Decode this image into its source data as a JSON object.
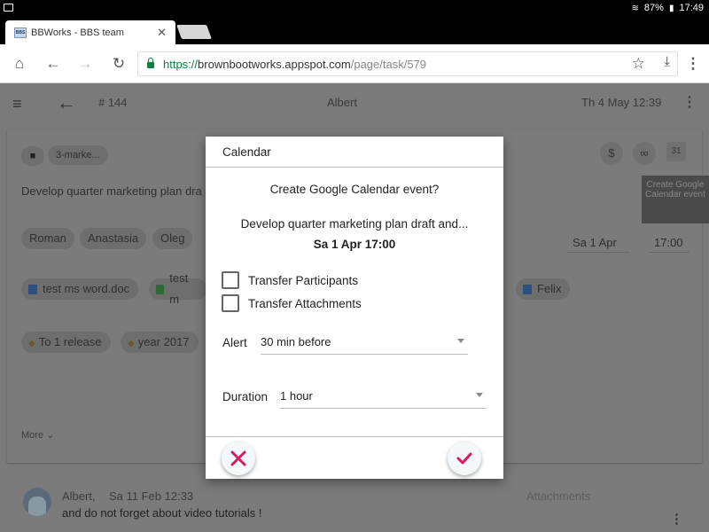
{
  "status_bar": {
    "battery": "87%",
    "time": "17:49"
  },
  "browser": {
    "tab": {
      "favicon_text": "BBS",
      "title": "BBWorks - BBS team"
    },
    "url": {
      "scheme": "https://",
      "host": "brownbootworks.appspot.com",
      "path": "/page/task/579"
    }
  },
  "app_header": {
    "task_number": "# 144",
    "user": "Albert",
    "datetime": "Th 4 May 12:39"
  },
  "task": {
    "folder_label": "3-marke...",
    "title": "Develop quarter marketing plan dra",
    "participants": [
      "Roman",
      "Anastasia",
      "Oleg"
    ],
    "date": "Sa 1 Apr",
    "time": "17:00",
    "attachments": [
      "test ms word.doc",
      "test m"
    ],
    "contact": "Felix",
    "tags": [
      "To 1 release",
      "year 2017"
    ],
    "more_label": "More",
    "tooltip": "Create Google Calendar event"
  },
  "comment": {
    "author": "Albert,",
    "date": "Sa 11 Feb 12:33",
    "text": "and do not forget about video tutorials !",
    "attachments_label": "Attachments"
  },
  "modal": {
    "title": "Calendar",
    "question": "Create Google Calendar event?",
    "task_name": "Develop quarter marketing plan draft and...",
    "event_datetime": "Sa 1 Apr 17:00",
    "options": [
      {
        "label": "Transfer Participants",
        "checked": false
      },
      {
        "label": "Transfer Attachments",
        "checked": false
      }
    ],
    "alert_label": "Alert",
    "alert_value": "30 min before",
    "duration_label": "Duration",
    "duration_value": "1 hour"
  },
  "colors": {
    "accent": "#d81b60",
    "url_green": "#0b8043"
  }
}
